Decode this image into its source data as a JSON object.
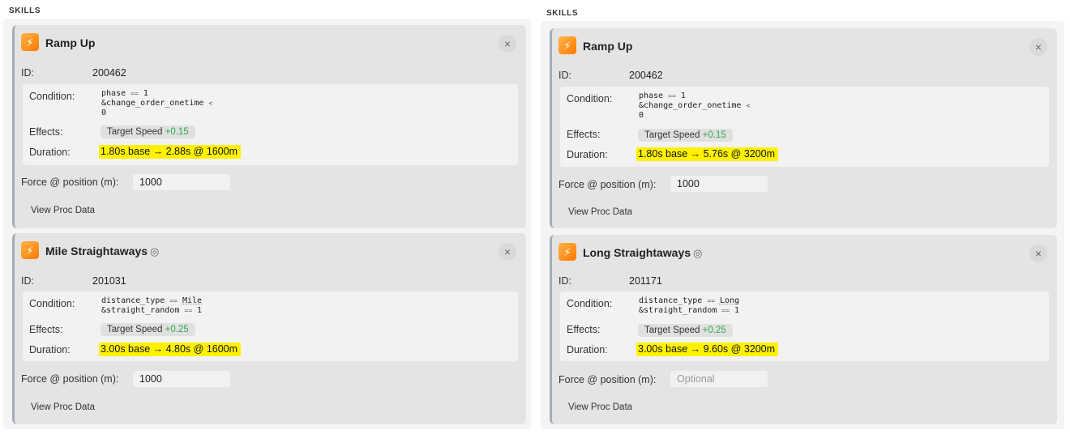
{
  "panels": [
    {
      "section_label": "SKILLS",
      "skills": [
        {
          "name": "Ramp Up",
          "rarity_icon": "",
          "close_glyph": "×",
          "id_label": "ID:",
          "id": "200462",
          "condition_label": "Condition:",
          "condition_lines": [
            {
              "lhs": "phase",
              "op": "==",
              "rhs": "1",
              "prefix": "",
              "dotted": false
            },
            {
              "lhs": "change_order_onetime",
              "op": "<",
              "rhs": "",
              "prefix": "&",
              "dotted": false
            },
            {
              "lhs": "0",
              "op": "",
              "rhs": "",
              "prefix": "",
              "dotted": false
            }
          ],
          "effects_label": "Effects:",
          "effect_name": "Target Speed",
          "effect_value": "+0.15",
          "duration_label": "Duration:",
          "duration": "1.80s base → 2.88s @ 1600m",
          "force_label": "Force @ position (m):",
          "force_value": "1000",
          "force_placeholder": "Optional",
          "view_proc_label": "View Proc Data"
        },
        {
          "name": "Mile Straightaways",
          "rarity_icon": "◎",
          "close_glyph": "×",
          "id_label": "ID:",
          "id": "201031",
          "condition_label": "Condition:",
          "condition_lines": [
            {
              "lhs": "distance_type",
              "op": "==",
              "rhs": "Mile",
              "prefix": "",
              "dotted": true
            },
            {
              "lhs": "straight_random",
              "op": "==",
              "rhs": "1",
              "prefix": "&",
              "dotted": false
            }
          ],
          "effects_label": "Effects:",
          "effect_name": "Target Speed",
          "effect_value": "+0.25",
          "duration_label": "Duration:",
          "duration": "3.00s base → 4.80s @ 1600m",
          "force_label": "Force @ position (m):",
          "force_value": "1000",
          "force_placeholder": "Optional",
          "view_proc_label": "View Proc Data"
        }
      ]
    },
    {
      "section_label": "SKILLS",
      "skills": [
        {
          "name": "Ramp Up",
          "rarity_icon": "",
          "close_glyph": "×",
          "id_label": "ID:",
          "id": "200462",
          "condition_label": "Condition:",
          "condition_lines": [
            {
              "lhs": "phase",
              "op": "==",
              "rhs": "1",
              "prefix": "",
              "dotted": false
            },
            {
              "lhs": "change_order_onetime",
              "op": "<",
              "rhs": "",
              "prefix": "&",
              "dotted": false
            },
            {
              "lhs": "0",
              "op": "",
              "rhs": "",
              "prefix": "",
              "dotted": false
            }
          ],
          "effects_label": "Effects:",
          "effect_name": "Target Speed",
          "effect_value": "+0.15",
          "duration_label": "Duration:",
          "duration": "1.80s base → 5.76s @ 3200m",
          "force_label": "Force @ position (m):",
          "force_value": "1000",
          "force_placeholder": "Optional",
          "view_proc_label": "View Proc Data"
        },
        {
          "name": "Long Straightaways",
          "rarity_icon": "◎",
          "close_glyph": "×",
          "id_label": "ID:",
          "id": "201171",
          "condition_label": "Condition:",
          "condition_lines": [
            {
              "lhs": "distance_type",
              "op": "==",
              "rhs": "Long",
              "prefix": "",
              "dotted": true
            },
            {
              "lhs": "straight_random",
              "op": "==",
              "rhs": "1",
              "prefix": "&",
              "dotted": false
            }
          ],
          "effects_label": "Effects:",
          "effect_name": "Target Speed",
          "effect_value": "+0.25",
          "duration_label": "Duration:",
          "duration": "3.00s base → 9.60s @ 3200m",
          "force_label": "Force @ position (m):",
          "force_value": "",
          "force_placeholder": "Optional",
          "view_proc_label": "View Proc Data"
        }
      ]
    }
  ],
  "colors": {
    "highlight": "#fff200",
    "effect_plus": "#2fa84f",
    "card_bg": "#e4e4e4",
    "card_accent": "#a7adb5",
    "skill_icon": "#ff8a00"
  },
  "icons": {
    "skill": "running-figure-icon",
    "close": "close-icon",
    "rarity": "rare-circle-icon"
  }
}
